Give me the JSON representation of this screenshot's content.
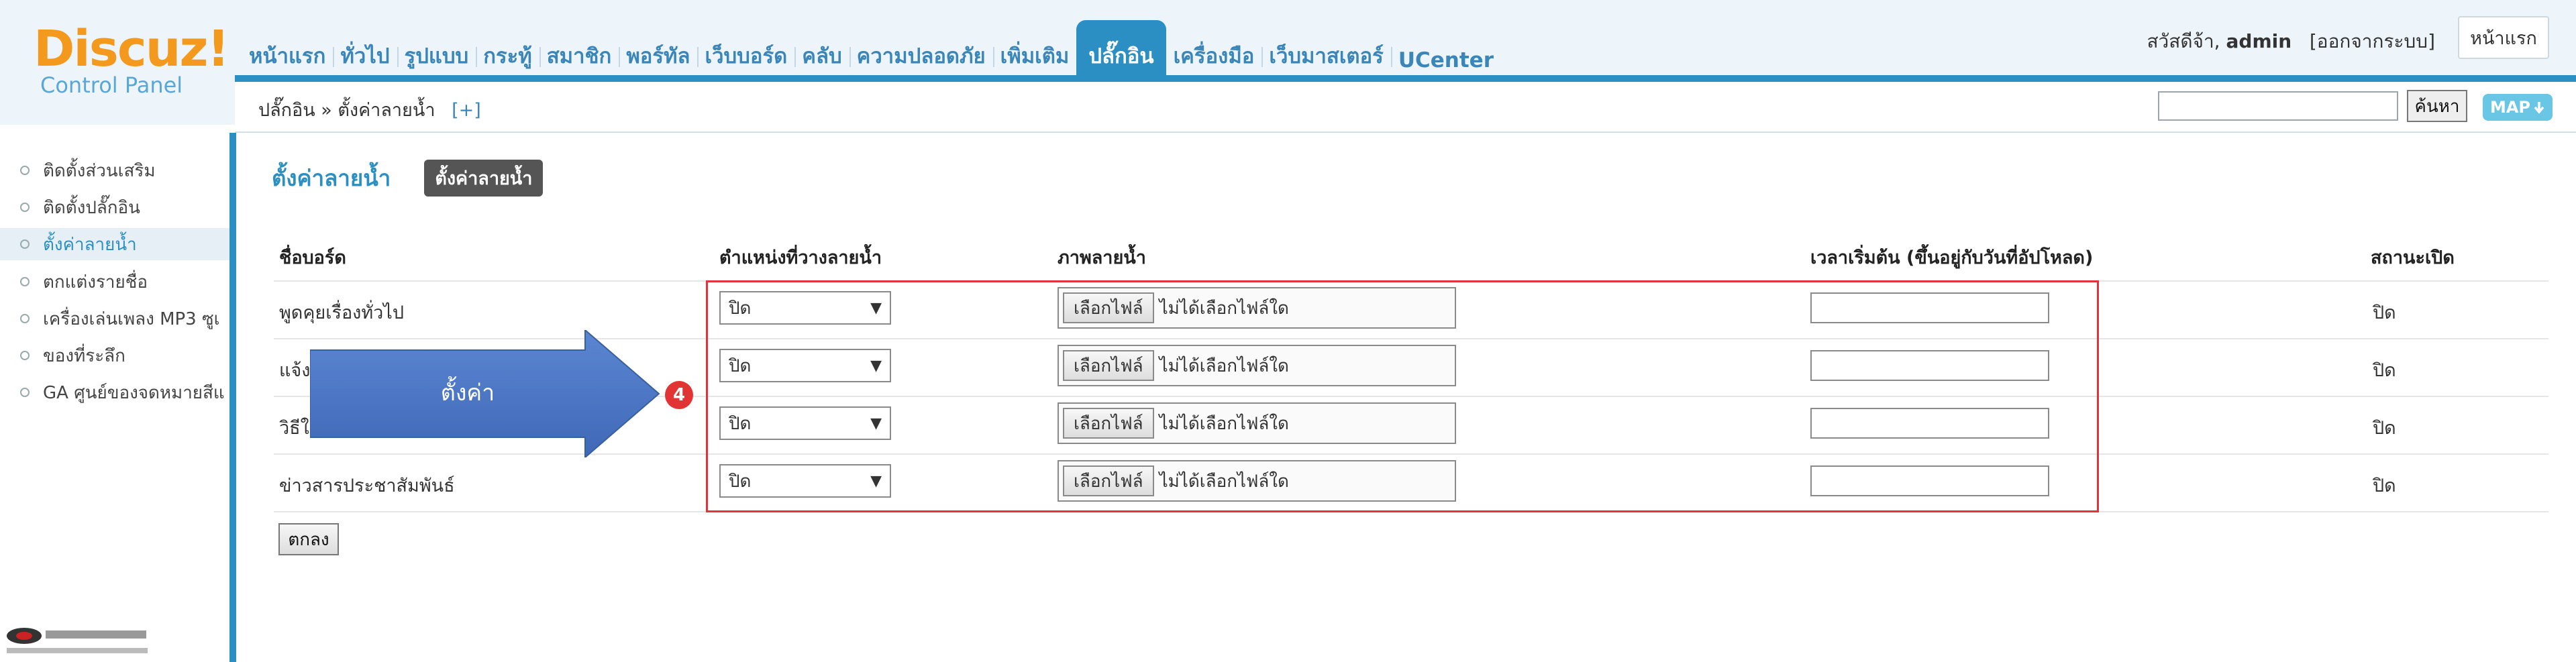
{
  "logo": {
    "main": "Discuz!",
    "sub": "Control Panel"
  },
  "nav": [
    "หน้าแรก",
    "ทั่วไป",
    "รูปแบบ",
    "กระทู้",
    "สมาชิก",
    "พอร์ทัล",
    "เว็บบอร์ด",
    "คลับ",
    "ความปลอดภัย",
    "เพิ่มเติม",
    "ปลั๊กอิน",
    "เครื่องมือ",
    "เว็บมาสเตอร์",
    "UCenter"
  ],
  "nav_active": "ปลั๊กอิน",
  "user": {
    "greeting": "สวัสดีจ้า,",
    "name": "admin",
    "logout": "[ออกจากระบบ]",
    "home_button": "หน้าแรก"
  },
  "breadcrumb": {
    "path": "ปลั๊กอิน » ตั้งค่าลายน้ำ",
    "plus": "[+]"
  },
  "search": {
    "button": "ค้นหา",
    "map": "MAP"
  },
  "sidebar": {
    "items": [
      {
        "label": "ติดตั้งส่วนเสริม",
        "active": false
      },
      {
        "label": "ติดตั้งปลั๊กอิน",
        "active": false
      },
      {
        "label": "ตั้งค่าลายน้ำ",
        "active": true
      },
      {
        "label": "ตกแต่งรายชื่อ",
        "active": false
      },
      {
        "label": "เครื่องเล่นเพลง MP3 ซูเ",
        "active": false
      },
      {
        "label": "ของที่ระลึก",
        "active": false
      },
      {
        "label": "GA ศูนย์ของจดหมายสีแ",
        "active": false
      }
    ]
  },
  "page": {
    "title": "ตั้งค่าลายน้ำ",
    "tab": "ตั้งค่าลายน้ำ"
  },
  "table": {
    "headers": [
      "ชื่อบอร์ด",
      "ตำแหน่งที่วางลายน้ำ",
      "ภาพลายน้ำ",
      "เวลาเริ่มต้น (ขึ้นอยู่กับวันที่อัปโหลด)",
      "สถานะเปิด"
    ],
    "rows": [
      {
        "board": "พูดคุยเรื่องทั่วไป",
        "position": "ปิด",
        "file_button": "เลือกไฟล์",
        "file_status": "ไม่ได้เลือกไฟล์ใด",
        "status": "ปิด"
      },
      {
        "board": "แจ้งปั",
        "position": "ปิด",
        "file_button": "เลือกไฟล์",
        "file_status": "ไม่ได้เลือกไฟล์ใด",
        "status": "ปิด"
      },
      {
        "board": "วิธีใช้",
        "position": "ปิด",
        "file_button": "เลือกไฟล์",
        "file_status": "ไม่ได้เลือกไฟล์ใด",
        "status": "ปิด"
      },
      {
        "board": "ข่าวสารประชาสัมพันธ์",
        "position": "ปิด",
        "file_button": "เลือกไฟล์",
        "file_status": "ไม่ได้เลือกไฟล์ใด",
        "status": "ปิด"
      }
    ]
  },
  "submit": "ตกลง",
  "callout": {
    "label": "ตั้งค่า",
    "badge": "4"
  },
  "colors": {
    "accent": "#2b8fc4",
    "logo_orange": "#f39a1e",
    "highlight_red": "#e3323a",
    "arrow_blue": "#4f7bc8"
  },
  "icons": {
    "map": "arrow-down-icon",
    "sidebar_bullet": "circle-bullet-icon",
    "select": "triangle-down-icon"
  }
}
